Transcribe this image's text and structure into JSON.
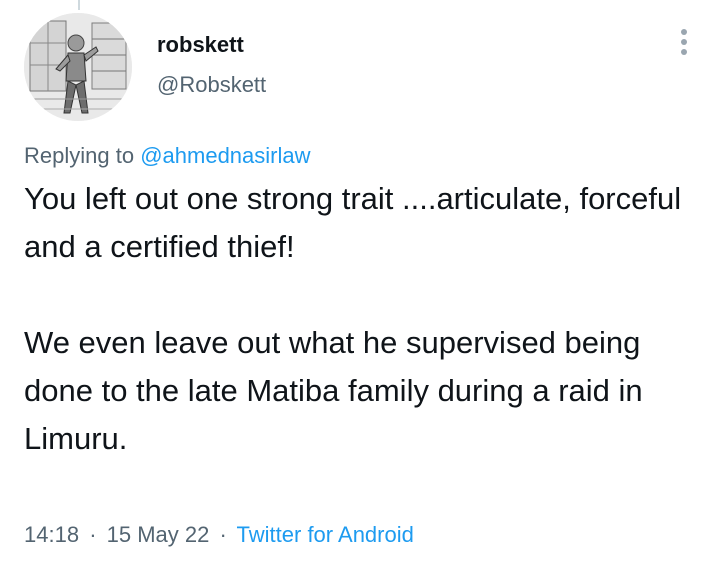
{
  "tweet": {
    "author": {
      "display_name": "robskett",
      "handle": "@Robskett"
    },
    "replying_prefix": "Replying to",
    "replying_to": "@ahmednasirlaw",
    "text_paragraphs": [
      "You left out one strong trait ....articulate, forceful and a certified thief!",
      "We even leave out what he supervised being done to the late Matiba family during a raid in Limuru."
    ],
    "time": "14:18",
    "date": "15 May 22",
    "source": "Twitter for Android",
    "separator": "·"
  },
  "icons": {
    "more": "more-vertical-icon"
  },
  "colors": {
    "link": "#1d9bf0",
    "secondary_text": "#536471",
    "primary_text": "#0f1419"
  }
}
